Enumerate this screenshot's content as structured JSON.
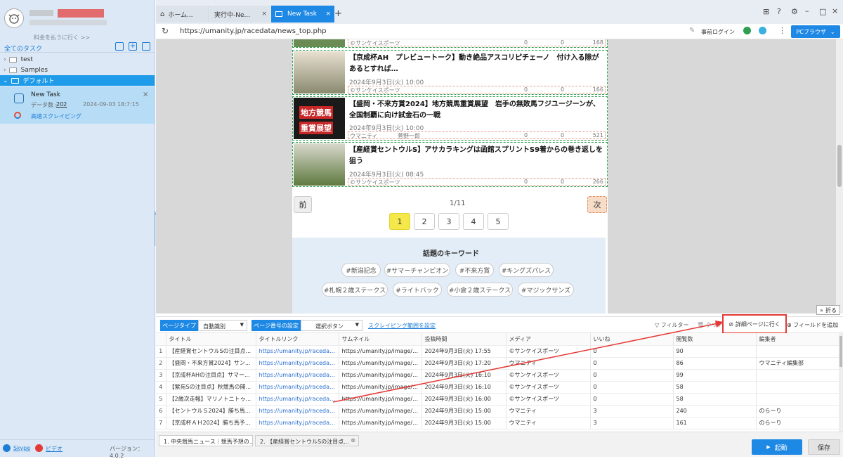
{
  "sidebar": {
    "pay_link": "料金を払うに行く >>",
    "all_tasks": "全てのタスク",
    "folders": [
      {
        "label": "test"
      },
      {
        "label": "Samples"
      },
      {
        "label": "デフォルト"
      }
    ],
    "task": {
      "name": "New Task",
      "count_label": "データ数 :",
      "count": "202",
      "timestamp": "2024-09-03 18:7:15",
      "mode": "高速スクレイピング"
    },
    "skype": "Skype",
    "video": "ビデオ",
    "version": "バージョン：4.0.2"
  },
  "tabs": [
    {
      "label": "ホーム..."
    },
    {
      "label": "実行中-Ne..."
    },
    {
      "label": "New Task"
    }
  ],
  "address": {
    "url": "https://umanity.jp/racedata/news_top.php",
    "login": "事前ログイン",
    "browser_button": "PCブラウザ"
  },
  "articles": [
    {
      "title": "【京成杯AH　プレビュートーク】動き絶品アスコリピチェーノ　付け入る隙があるとすれば…",
      "date": "2024年9月3日(火) 10:00",
      "source": "©サンケイスポーツ",
      "comments": "0",
      "likes": "0",
      "views": "166"
    },
    {
      "title": "【盛岡・不来方賞2024】地方競馬重賞展望　岩手の無敗馬フジユージーンが、全国制覇に向け試金石の一戦",
      "date": "2024年9月3日(火) 10:00",
      "source": "ウマニティ",
      "author": "菅野一郎",
      "comments": "0",
      "likes": "0",
      "views": "521",
      "thumb_text_1": "地方競馬",
      "thumb_text_2": "重賞展望"
    },
    {
      "title": "【産経賞セントウルS】アサカラキングは函館スプリントS9着からの巻き返しを狙う",
      "date": "2024年9月3日(火) 08:45",
      "source": "©サンケイスポーツ",
      "comments": "0",
      "likes": "0",
      "views": "266"
    }
  ],
  "top_partial": {
    "source": "©サンケイスポーツ",
    "comments": "0",
    "likes": "0",
    "views": "168"
  },
  "pagination": {
    "prev": "前",
    "next": "次",
    "page_info": "1/11",
    "pages": [
      "1",
      "2",
      "3",
      "4",
      "5"
    ]
  },
  "keywords": {
    "heading": "話題のキーワード",
    "items": [
      "#新潟記念",
      "#サマーチャンピオン",
      "#不来方賞",
      "#キングズパレス",
      "#札幌２歳ステークス",
      "#ライトバック",
      "#小倉２歳ステークス",
      "#マジックサンズ"
    ]
  },
  "fold_button": "折る",
  "toolbar": {
    "page_type_label": "ページタイプ",
    "page_type_value": "自動識別",
    "page_no_label": "ページ番号の設定",
    "page_no_value": "選択ボタン",
    "scrape_range": "スクレイピング範囲を設定",
    "filter": "フィルター",
    "clear": "クリア",
    "detail": "詳細ページに行く",
    "add_field": "フィールドを追加"
  },
  "table": {
    "headers": [
      "",
      "タイトル",
      "タイトルリンク",
      "サムネイル",
      "投稿時間",
      "メディア",
      "いいね",
      "閲覧数",
      "編集者"
    ],
    "rows": [
      [
        "1",
        "【産経賞セントウルSの注目点...",
        "https://umanity.jp/racedata/race...",
        "https://umanity.jp/image/news/s...",
        "2024年9月3日(火) 17:55",
        "©サンケイスポーツ",
        "0",
        "90",
        ""
      ],
      [
        "2",
        "【盛岡・不来方賞2024】サン...",
        "https://umanity.jp/racedata/race...",
        "https://umanity.jp/image/news/s...",
        "2024年9月3日(火) 17:20",
        "ウマニティ",
        "0",
        "86",
        "ウマニティ編集部"
      ],
      [
        "3",
        "【京成杯AHの注目点】サマー...",
        "https://umanity.jp/racedata/race...",
        "https://umanity.jp/image/news/s...",
        "2024年9月3日(火) 16:10",
        "©サンケイスポーツ",
        "0",
        "99",
        ""
      ],
      [
        "4",
        "【紫苑Sの注目点】秋競馬の開...",
        "https://umanity.jp/racedata/race...",
        "https://umanity.jp/image/news/s...",
        "2024年9月3日(火) 16:10",
        "©サンケイスポーツ",
        "0",
        "58",
        ""
      ],
      [
        "5",
        "【2歳次走報】マリノトニトゥ...",
        "https://umanity.jp/racedata/race...",
        "https://umanity.jp/image/news/s...",
        "2024年9月3日(火) 16:00",
        "©サンケイスポーツ",
        "0",
        "58",
        ""
      ],
      [
        "6",
        "【セントウルＳ2024】勝ち馬...",
        "https://umanity.jp/racedata/race...",
        "https://umanity.jp/image/news/s...",
        "2024年9月3日(火) 15:00",
        "ウマニティ",
        "3",
        "240",
        "のらーり"
      ],
      [
        "7",
        "【京成杯ＡＨ2024】勝ち馬予...",
        "https://umanity.jp/racedata/race...",
        "https://umanity.jp/image/news/s...",
        "2024年9月3日(火) 15:00",
        "ウマニティ",
        "3",
        "161",
        "のらーり"
      ]
    ]
  },
  "bottom_tabs": [
    "1. 中央競馬ニュース｜競馬予想の...",
    "2. 【産経賞セントウルSの注目点..."
  ],
  "actions": {
    "start": "起動",
    "save": "保存"
  },
  "colors": {
    "accent": "#1e88e5",
    "selected": "#1e9be9",
    "highlight": "#e53935"
  }
}
